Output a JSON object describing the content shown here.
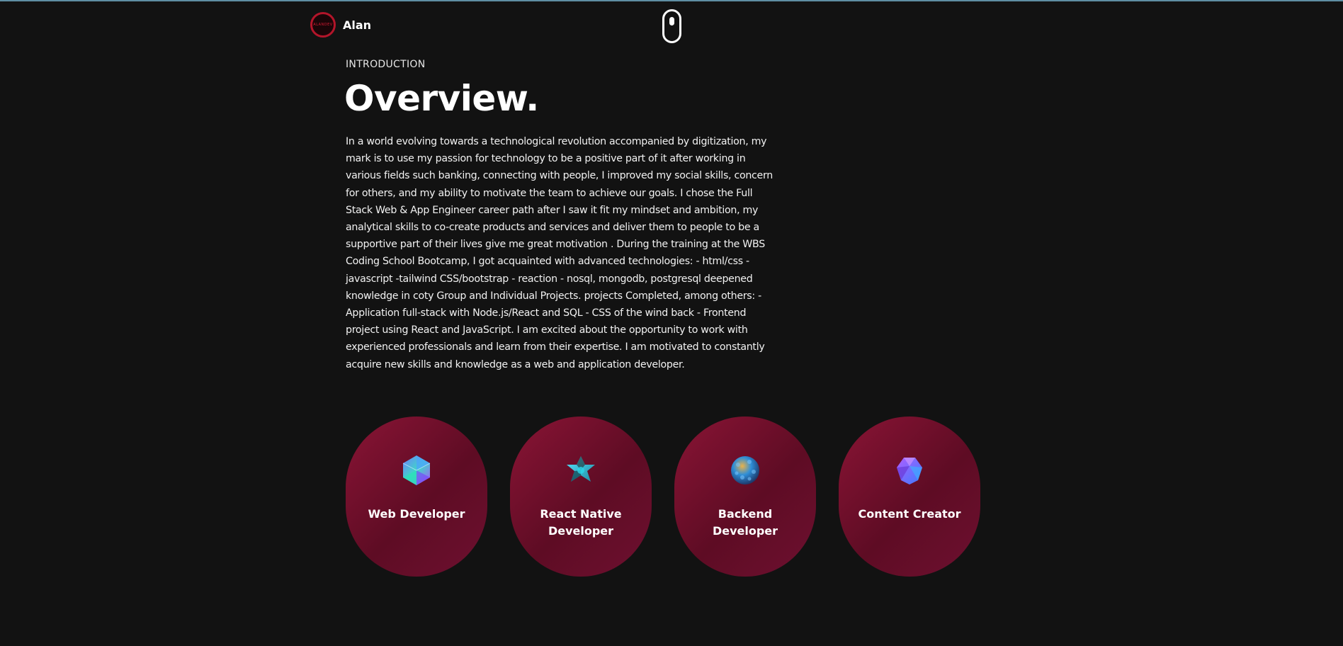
{
  "header": {
    "logo_text": "ALANDEV",
    "brand_name": "Alan"
  },
  "intro": {
    "subtitle": "INTRODUCTION",
    "title": "Overview.",
    "paragraph": "In a world evolving towards a technological revolution accompanied by digitization, my mark is to use my passion for technology to be a positive part of it after working in various fields such banking, connecting with people, I improved my social skills, concern for others, and my ability to motivate the team to achieve our goals. I chose the Full Stack Web & App Engineer career path after I saw it fit my mindset and ambition, my analytical skills to co-create products and services and deliver them to people to be a supportive part of their lives give me great motivation . During the training at the WBS Coding School Bootcamp, I got acquainted with advanced technologies: - html/css - javascript -tailwind CSS/bootstrap - reaction - nosql, mongodb, postgresql deepened knowledge in coty Group and Individual Projects. projects Completed, among others: - Application full-stack with Node.js/React and SQL - CSS of the wind back - Frontend project using React and JavaScript. I am excited about the opportunity to work with experienced professionals and learn from their expertise. I am motivated to constantly acquire new skills and knowledge as a web and application developer."
  },
  "services": [
    {
      "title": "Web Developer",
      "icon": "crystal-icosahedron-icon",
      "color": "#3fd6c8"
    },
    {
      "title": "React Native Developer",
      "icon": "crystal-star-icon",
      "color": "#36c9d9"
    },
    {
      "title": "Backend Developer",
      "icon": "crystal-sphere-icon",
      "color": "#2f8fd8"
    },
    {
      "title": "Content Creator",
      "icon": "crystal-cluster-icon",
      "color": "#8d5cf5"
    }
  ],
  "colors": {
    "background": "#121212",
    "card_gradient_start": "#8a1435",
    "card_gradient_end": "#5e0c24",
    "accent_top_border": "#5f8ea3"
  }
}
